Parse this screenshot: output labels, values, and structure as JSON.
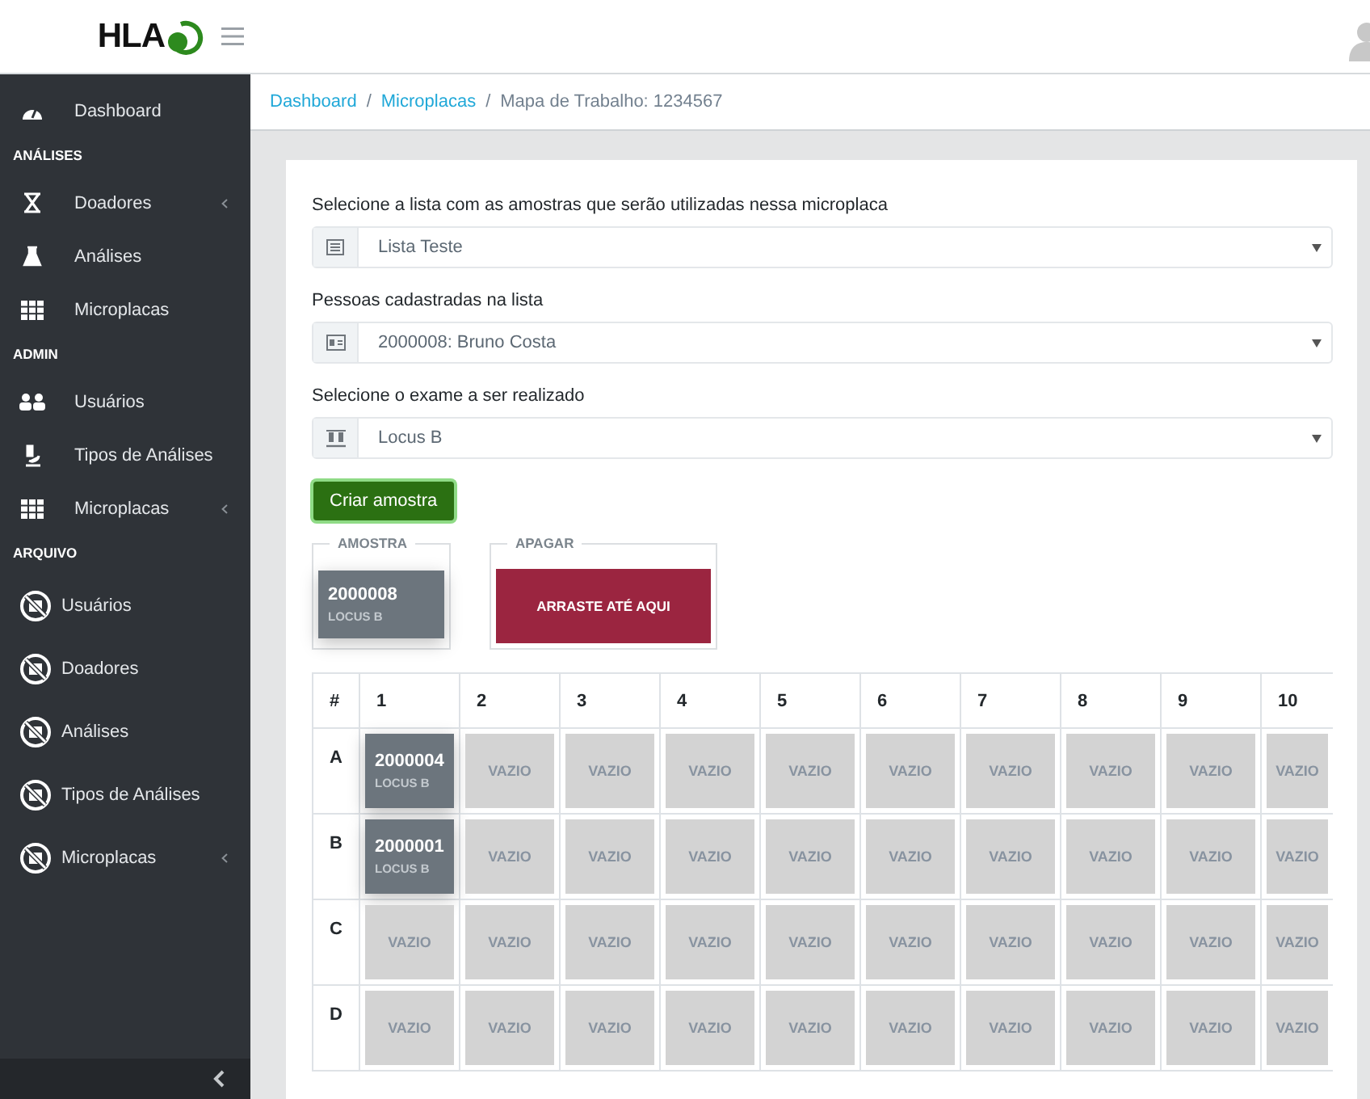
{
  "header": {
    "logo": "HLA"
  },
  "sidebar": {
    "items": [
      {
        "kind": "link",
        "label": "Dashboard",
        "submenu": false
      },
      {
        "kind": "section",
        "label": "ANÁLISES"
      },
      {
        "kind": "link",
        "label": "Doadores",
        "submenu": true
      },
      {
        "kind": "link",
        "label": "Análises",
        "submenu": false
      },
      {
        "kind": "link",
        "label": "Microplacas",
        "submenu": false
      },
      {
        "kind": "section",
        "label": "ADMIN"
      },
      {
        "kind": "link",
        "label": "Usuários",
        "submenu": false
      },
      {
        "kind": "link",
        "label": "Tipos de Análises",
        "submenu": false
      },
      {
        "kind": "link",
        "label": "Microplacas",
        "submenu": true
      },
      {
        "kind": "section",
        "label": "ARQUIVO"
      },
      {
        "kind": "archive",
        "label": "Usuários",
        "submenu": false
      },
      {
        "kind": "archive",
        "label": "Doadores",
        "submenu": false
      },
      {
        "kind": "archive",
        "label": "Análises",
        "submenu": false
      },
      {
        "kind": "archive",
        "label": "Tipos de Análises",
        "submenu": false
      },
      {
        "kind": "archive",
        "label": "Microplacas",
        "submenu": true
      }
    ]
  },
  "breadcrumb": {
    "separator": "/",
    "items": [
      {
        "label": "Dashboard",
        "link": true
      },
      {
        "label": "Microplacas",
        "link": true
      },
      {
        "label": "Mapa de Trabalho: 1234567",
        "link": false
      }
    ]
  },
  "form": {
    "fields": [
      {
        "label": "Selecione a lista com as amostras que serão utilizadas nessa microplaca",
        "value": "Lista Teste"
      },
      {
        "label": "Pessoas cadastradas na lista",
        "value": "2000008: Bruno Costa"
      },
      {
        "label": "Selecione o exame a ser realizado",
        "value": "Locus B"
      }
    ],
    "button": "Criar amostra"
  },
  "sample_box": {
    "legend": "AMOSTRA",
    "id": "2000008",
    "locus": "LOCUS B"
  },
  "delete_box": {
    "legend": "APAGAR",
    "text": "ARRASTE ATÉ AQUI"
  },
  "plate": {
    "columns": [
      "#",
      "1",
      "2",
      "3",
      "4",
      "5",
      "6",
      "7",
      "8",
      "9",
      "10"
    ],
    "rows": [
      {
        "label": "A",
        "wells": [
          {
            "kind": "sample",
            "id": "2000004",
            "locus": "LOCUS B"
          },
          {
            "kind": "empty",
            "text": "VAZIO"
          },
          {
            "kind": "empty",
            "text": "VAZIO"
          },
          {
            "kind": "empty",
            "text": "VAZIO"
          },
          {
            "kind": "empty",
            "text": "VAZIO"
          },
          {
            "kind": "empty",
            "text": "VAZIO"
          },
          {
            "kind": "empty",
            "text": "VAZIO"
          },
          {
            "kind": "empty",
            "text": "VAZIO"
          },
          {
            "kind": "empty",
            "text": "VAZIO"
          },
          {
            "kind": "empty",
            "text": "VAZIO"
          }
        ]
      },
      {
        "label": "B",
        "wells": [
          {
            "kind": "sample",
            "id": "2000001",
            "locus": "LOCUS B"
          },
          {
            "kind": "empty",
            "text": "VAZIO"
          },
          {
            "kind": "empty",
            "text": "VAZIO"
          },
          {
            "kind": "empty",
            "text": "VAZIO"
          },
          {
            "kind": "empty",
            "text": "VAZIO"
          },
          {
            "kind": "empty",
            "text": "VAZIO"
          },
          {
            "kind": "empty",
            "text": "VAZIO"
          },
          {
            "kind": "empty",
            "text": "VAZIO"
          },
          {
            "kind": "empty",
            "text": "VAZIO"
          },
          {
            "kind": "empty",
            "text": "VAZIO"
          }
        ]
      },
      {
        "label": "C",
        "wells": [
          {
            "kind": "empty",
            "text": "VAZIO"
          },
          {
            "kind": "empty",
            "text": "VAZIO"
          },
          {
            "kind": "empty",
            "text": "VAZIO"
          },
          {
            "kind": "empty",
            "text": "VAZIO"
          },
          {
            "kind": "empty",
            "text": "VAZIO"
          },
          {
            "kind": "empty",
            "text": "VAZIO"
          },
          {
            "kind": "empty",
            "text": "VAZIO"
          },
          {
            "kind": "empty",
            "text": "VAZIO"
          },
          {
            "kind": "empty",
            "text": "VAZIO"
          },
          {
            "kind": "empty",
            "text": "VAZIO"
          }
        ]
      },
      {
        "label": "D",
        "wells": [
          {
            "kind": "empty",
            "text": "VAZIO"
          },
          {
            "kind": "empty",
            "text": "VAZIO"
          },
          {
            "kind": "empty",
            "text": "VAZIO"
          },
          {
            "kind": "empty",
            "text": "VAZIO"
          },
          {
            "kind": "empty",
            "text": "VAZIO"
          },
          {
            "kind": "empty",
            "text": "VAZIO"
          },
          {
            "kind": "empty",
            "text": "VAZIO"
          },
          {
            "kind": "empty",
            "text": "VAZIO"
          },
          {
            "kind": "empty",
            "text": "VAZIO"
          },
          {
            "kind": "empty",
            "text": "VAZIO"
          }
        ]
      }
    ]
  }
}
